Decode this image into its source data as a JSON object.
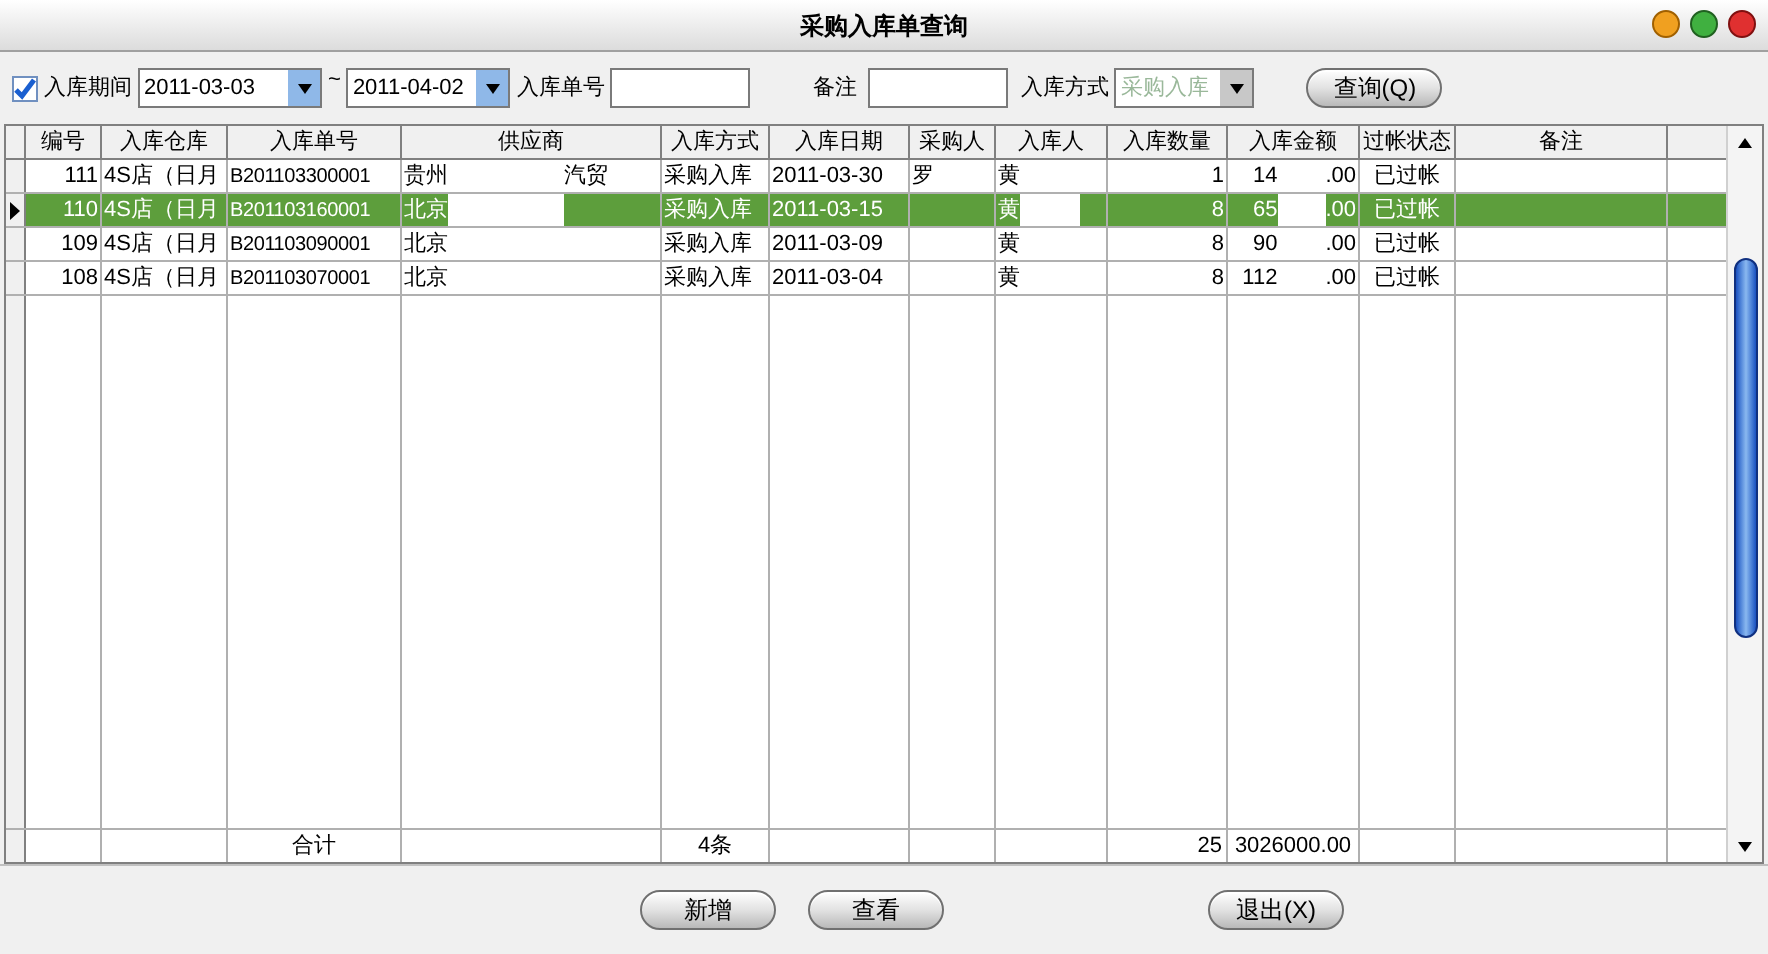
{
  "window": {
    "title": "采购入库单查询"
  },
  "filters": {
    "period": {
      "label": "入库期间",
      "checked": true,
      "from": "2011-03-03",
      "separator": "~",
      "to": "2011-04-02"
    },
    "order_no": {
      "label": "入库单号"
    },
    "remark": {
      "label": "备注"
    },
    "method": {
      "label": "入库方式",
      "value": "采购入库",
      "disabled": true
    },
    "query_button": "查询(Q)"
  },
  "table": {
    "columns": [
      "编号",
      "入库仓库",
      "入库单号",
      "供应商",
      "入库方式",
      "入库日期",
      "采购人",
      "入库人",
      "入库数量",
      "入库金额",
      "过帐状态",
      "备注"
    ],
    "rows": [
      {
        "selected": false,
        "cells": [
          [
            "111"
          ],
          [
            "4S店（日月"
          ],
          [
            "B201103300001"
          ],
          [
            "贵州",
            "汽贸"
          ],
          [
            "采购入库"
          ],
          [
            "2011-03-30"
          ],
          [
            "罗"
          ],
          [
            "黄"
          ],
          [
            "1"
          ],
          [
            "14",
            ".00"
          ],
          [
            "已过帐"
          ],
          []
        ]
      },
      {
        "selected": true,
        "cells": [
          [
            "110"
          ],
          [
            "4S店（日月"
          ],
          [
            "B201103160001"
          ],
          [
            "北京",
            ""
          ],
          [
            "采购入库"
          ],
          [
            "2011-03-15"
          ],
          [],
          [
            "黄",
            ""
          ],
          [
            "8"
          ],
          [
            "65",
            ".00"
          ],
          [
            "已过帐"
          ],
          []
        ]
      },
      {
        "selected": false,
        "cells": [
          [
            "109"
          ],
          [
            "4S店（日月"
          ],
          [
            "B201103090001"
          ],
          [
            "北京",
            ""
          ],
          [
            "采购入库"
          ],
          [
            "2011-03-09"
          ],
          [],
          [
            "黄"
          ],
          [
            "8"
          ],
          [
            "90",
            ".00"
          ],
          [
            "已过帐"
          ],
          []
        ]
      },
      {
        "selected": false,
        "cells": [
          [
            "108"
          ],
          [
            "4S店（日月"
          ],
          [
            "B201103070001"
          ],
          [
            "北京"
          ],
          [
            "采购入库"
          ],
          [
            "2011-03-04"
          ],
          [],
          [
            "黄"
          ],
          [
            "8"
          ],
          [
            "112",
            ".00"
          ],
          [
            "已过帐"
          ],
          []
        ]
      }
    ],
    "totals": {
      "label": "合计",
      "count": "4条",
      "quantity": "25",
      "amount": "3026000.00"
    }
  },
  "buttons": [
    "新增",
    "查看",
    "退出(X)"
  ]
}
